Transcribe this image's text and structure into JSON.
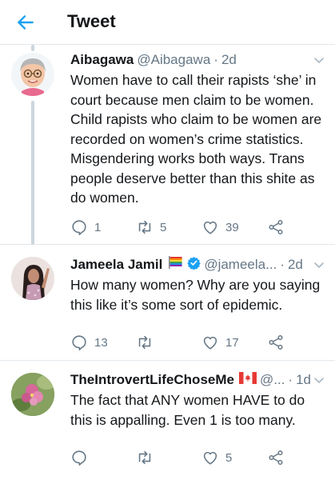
{
  "header": {
    "title": "Tweet"
  },
  "tweets": [
    {
      "name": "Aibagawa",
      "handle": "@Aibagawa",
      "sep": "·",
      "time": "2d",
      "text": "Women have to call their rapists ‘she’ in court because men claim to be women. Child rapists who claim to be women are recorded on women’s crime statistics. Misgendering works both ways. Trans people deserve better than this shite as do women.",
      "replies": "1",
      "retweets": "5",
      "likes": "39",
      "avatar_icon": "memoji-avatar"
    },
    {
      "name": "Jameela Jamil",
      "handle": "@jameela...",
      "sep": "·",
      "time": "2d",
      "text": "How many women? Why are you saying this like it’s some sort of epidemic.",
      "replies": "13",
      "retweets": "",
      "likes": "17",
      "badges": [
        "rainbow-flag-emoji",
        "verified-badge-icon"
      ],
      "avatar_icon": "photo-avatar"
    },
    {
      "name": "TheIntrovertLifeChoseMe",
      "handle": "@...",
      "sep": "·",
      "time": "1d",
      "text": "The fact that ANY women HAVE to do this is appalling. Even 1 is too many.",
      "replies": "",
      "retweets": "",
      "likes": "5",
      "badges": [
        "canada-flag-emoji"
      ],
      "avatar_icon": "flower-avatar"
    }
  ],
  "colors": {
    "accent": "#1da1f2",
    "text": "#14171a",
    "secondary": "#657786",
    "divider": "#e1e8ed"
  }
}
